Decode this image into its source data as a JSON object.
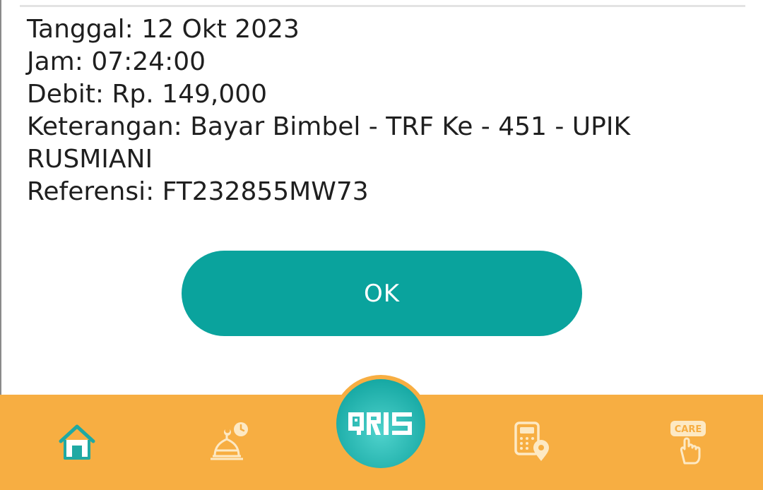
{
  "transaction": {
    "date_line": "Tanggal: 12 Okt 2023",
    "time_line": "Jam: 07:24:00",
    "debit_line": "Debit: Rp. 149,000",
    "description_line_1": "Keterangan: Bayar Bimbel - TRF Ke - 451 - UPIK",
    "description_line_2": "RUSMIANI",
    "reference_line": "Referensi: FT232855MW73"
  },
  "ok_button": {
    "label": "OK"
  },
  "bottom_nav": {
    "items": [
      {
        "icon": "home-icon"
      },
      {
        "icon": "mosque-clock-icon"
      },
      {
        "icon": "qris-icon"
      },
      {
        "icon": "calculator-location-icon"
      },
      {
        "icon": "care-hand-icon",
        "label": "CARE"
      }
    ]
  },
  "colors": {
    "accent": "#0aa39d",
    "nav_background": "#f7ae42",
    "nav_icon": "#fde9c4",
    "home_icon": "#1fa9a3"
  }
}
